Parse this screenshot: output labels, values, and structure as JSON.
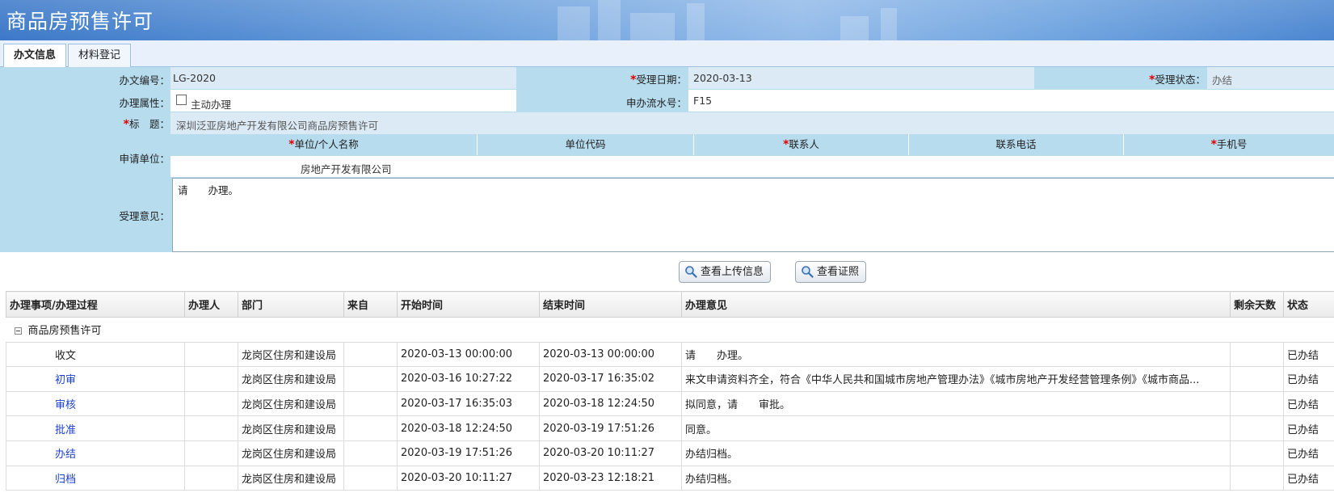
{
  "banner": {
    "title": "商品房预售许可"
  },
  "tabs": [
    {
      "label": "办文信息",
      "active": true
    },
    {
      "label": "材料登记",
      "active": false
    }
  ],
  "form": {
    "doc_no_label": "办文编号：",
    "doc_no_value": "LG-2020",
    "accept_date_label": "受理日期：",
    "accept_date_value": "2020-03-13",
    "accept_status_label": "受理状态：",
    "accept_status_value": "办结",
    "attr_label": "办理属性：",
    "attr_option": "主动办理",
    "serial_label": "申办流水号：",
    "serial_value": "F15",
    "title_label": "标　题：",
    "title_value": "深圳泛亚房地产开发有限公司商品房预售许可",
    "applicant_label": "申请单位：",
    "applicant_headers": [
      "单位/个人名称",
      "单位代码",
      "联系人",
      "联系电话",
      "手机号"
    ],
    "applicant_name_value": "房地产开发有限公司",
    "opinion_label": "受理意见：",
    "opinion_value": "请　　办理。"
  },
  "buttons": {
    "view_upload": "查看上传信息",
    "view_license": "查看证照"
  },
  "grid": {
    "headers": [
      "办理事项/办理过程",
      "办理人",
      "部门",
      "来自",
      "开始时间",
      "结束时间",
      "办理意见",
      "剩余天数",
      "状态"
    ],
    "group_label": "商品房预售许可",
    "rows": [
      {
        "step": "收文",
        "handler": "",
        "dept": "龙岗区住房和建设局",
        "from": "",
        "start": "2020-03-13 00:00:00",
        "end": "2020-03-13 00:00:00",
        "opinion": "请　　办理。",
        "days": "",
        "status": "已办结"
      },
      {
        "step": "初审",
        "handler": "",
        "dept": "龙岗区住房和建设局",
        "from": "",
        "start": "2020-03-16 10:27:22",
        "end": "2020-03-17 16:35:02",
        "opinion": "来文申请资料齐全，符合《中华人民共和国城市房地产管理办法》《城市房地产开发经营管理条例》《城市商品...",
        "days": "",
        "status": "已办结"
      },
      {
        "step": "审核",
        "handler": "",
        "dept": "龙岗区住房和建设局",
        "from": "",
        "start": "2020-03-17 16:35:03",
        "end": "2020-03-18 12:24:50",
        "opinion": "拟同意，请　　审批。",
        "days": "",
        "status": "已办结"
      },
      {
        "step": "批准",
        "handler": "",
        "dept": "龙岗区住房和建设局",
        "from": "",
        "start": "2020-03-18 12:24:50",
        "end": "2020-03-19 17:51:26",
        "opinion": "同意。",
        "days": "",
        "status": "已办结"
      },
      {
        "step": "办结",
        "handler": "",
        "dept": "龙岗区住房和建设局",
        "from": "",
        "start": "2020-03-19 17:51:26",
        "end": "2020-03-20 10:11:27",
        "opinion": "办结归档。",
        "days": "",
        "status": "已办结"
      },
      {
        "step": "归档",
        "handler": "",
        "dept": "龙岗区住房和建设局",
        "from": "",
        "start": "2020-03-20 10:11:27",
        "end": "2020-03-23 12:18:21",
        "opinion": "办结归档。",
        "days": "",
        "status": "已办结"
      }
    ]
  }
}
